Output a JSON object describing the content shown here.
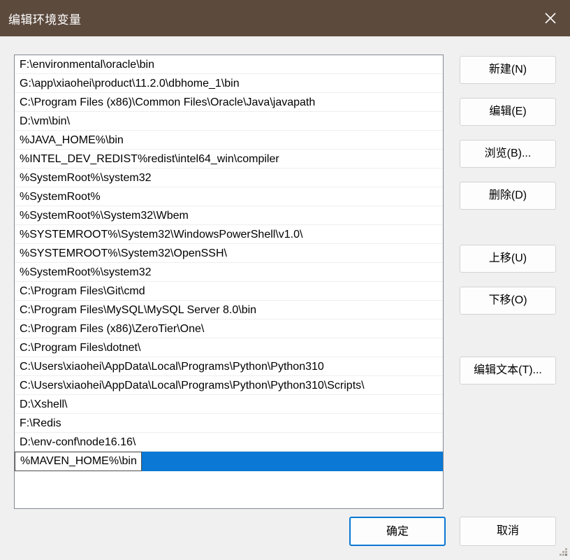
{
  "window": {
    "title": "编辑环境变量",
    "titlebar_color": "#5c4a3d",
    "accent_color": "#0a78d4",
    "close_icon": "close-icon"
  },
  "list": {
    "items": [
      "F:\\environmental\\oracle\\bin",
      "G:\\app\\xiaohei\\product\\11.2.0\\dbhome_1\\bin",
      "C:\\Program Files (x86)\\Common Files\\Oracle\\Java\\javapath",
      "D:\\vm\\bin\\",
      "%JAVA_HOME%\\bin",
      "%INTEL_DEV_REDIST%redist\\intel64_win\\compiler",
      "%SystemRoot%\\system32",
      "%SystemRoot%",
      "%SystemRoot%\\System32\\Wbem",
      "%SYSTEMROOT%\\System32\\WindowsPowerShell\\v1.0\\",
      "%SYSTEMROOT%\\System32\\OpenSSH\\",
      "%SystemRoot%\\system32",
      "C:\\Program Files\\Git\\cmd",
      "C:\\Program Files\\MySQL\\MySQL Server 8.0\\bin",
      "C:\\Program Files (x86)\\ZeroTier\\One\\",
      "C:\\Program Files\\dotnet\\",
      "C:\\Users\\xiaohei\\AppData\\Local\\Programs\\Python\\Python310",
      "C:\\Users\\xiaohei\\AppData\\Local\\Programs\\Python\\Python310\\Scripts\\",
      "D:\\Xshell\\",
      "F:\\Redis",
      "D:\\env-conf\\node16.16\\"
    ],
    "editing_row": {
      "value": "%MAVEN_HOME%\\bin",
      "selected": true
    }
  },
  "side_buttons": [
    {
      "label": "新建(N)",
      "name": "new-button"
    },
    {
      "label": "编辑(E)",
      "name": "edit-button"
    },
    {
      "label": "浏览(B)...",
      "name": "browse-button"
    },
    {
      "label": "删除(D)",
      "name": "delete-button"
    },
    {
      "label": "上移(U)",
      "name": "move-up-button"
    },
    {
      "label": "下移(O)",
      "name": "move-down-button"
    },
    {
      "label": "编辑文本(T)...",
      "name": "edit-text-button"
    }
  ],
  "bottom_buttons": {
    "ok": "确定",
    "cancel": "取消"
  }
}
